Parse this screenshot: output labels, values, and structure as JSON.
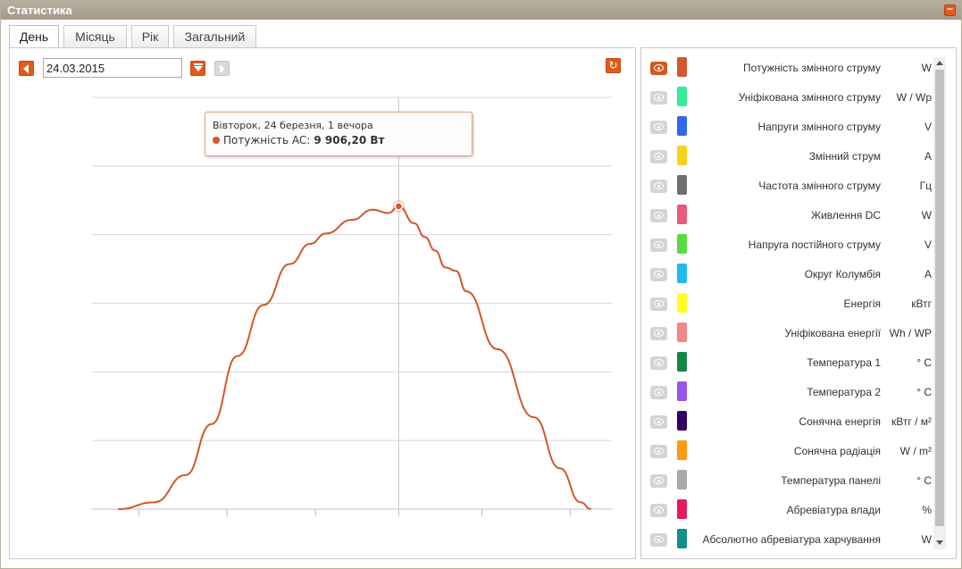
{
  "window": {
    "title": "Статистика",
    "minimize_label": "−"
  },
  "tabs": [
    {
      "label": "День",
      "active": true
    },
    {
      "label": "Місяць",
      "active": false
    },
    {
      "label": "Рік",
      "active": false
    },
    {
      "label": "Загальний",
      "active": false
    }
  ],
  "toolbar": {
    "date_value": "24.03.2015",
    "refresh_icon": "refresh-icon"
  },
  "tooltip": {
    "date": "Вівторок, 24 березня, 1 вечора",
    "series_label": "Потужність AC:",
    "value": "9 906,20 Вт"
  },
  "chart_data": {
    "type": "line",
    "series": [
      {
        "color": "#d2572a",
        "points": [
          [
            0.05,
            0.0
          ],
          [
            0.12,
            0.02
          ],
          [
            0.18,
            0.1
          ],
          [
            0.23,
            0.25
          ],
          [
            0.28,
            0.45
          ],
          [
            0.33,
            0.6
          ],
          [
            0.38,
            0.72
          ],
          [
            0.42,
            0.78
          ],
          [
            0.45,
            0.81
          ],
          [
            0.5,
            0.85
          ],
          [
            0.54,
            0.88
          ],
          [
            0.57,
            0.87
          ],
          [
            0.59,
            0.89
          ],
          [
            0.62,
            0.84
          ],
          [
            0.64,
            0.8
          ],
          [
            0.66,
            0.76
          ],
          [
            0.68,
            0.71
          ],
          [
            0.7,
            0.7
          ],
          [
            0.72,
            0.64
          ],
          [
            0.78,
            0.47
          ],
          [
            0.85,
            0.27
          ],
          [
            0.9,
            0.12
          ],
          [
            0.94,
            0.02
          ],
          [
            0.96,
            0.0
          ]
        ]
      }
    ],
    "ylim": [
      0,
      1
    ],
    "grid": true,
    "peak_marker_index": 12
  },
  "legend": {
    "items": [
      {
        "label": "Потужність змінного струму",
        "unit": "W",
        "color": "#d2572a",
        "visible": true
      },
      {
        "label": "Уніфікована змінного струму",
        "unit": "W / Wp",
        "color": "#33ee99",
        "visible": false
      },
      {
        "label": "Напруги змінного струму",
        "unit": "V",
        "color": "#3366ee",
        "visible": false
      },
      {
        "label": "Змінний струм",
        "unit": "A",
        "color": "#f5d21a",
        "visible": false
      },
      {
        "label": "Частота змінного струму",
        "unit": "Гц",
        "color": "#6f6f6f",
        "visible": false
      },
      {
        "label": "Живлення DC",
        "unit": "W",
        "color": "#e85a7c",
        "visible": false
      },
      {
        "label": "Напруга постійного струму",
        "unit": "V",
        "color": "#55dd44",
        "visible": false
      },
      {
        "label": "Округ Колумбія",
        "unit": "A",
        "color": "#22bbee",
        "visible": false
      },
      {
        "label": "Енергія",
        "unit": "кВтг",
        "color": "#ffff22",
        "visible": false
      },
      {
        "label": "Уніфікована енергії",
        "unit": "Wh / WP",
        "color": "#f08888",
        "visible": false
      },
      {
        "label": "Температура 1",
        "unit": "° C",
        "color": "#118844",
        "visible": false
      },
      {
        "label": "Температура 2",
        "unit": "° C",
        "color": "#9955ee",
        "visible": false
      },
      {
        "label": "Сонячна енергія",
        "unit": "кВтг / м²",
        "color": "#330066",
        "visible": false
      },
      {
        "label": "Сонячна радіація",
        "unit": "W / m²",
        "color": "#ff9911",
        "visible": false
      },
      {
        "label": "Температура панелі",
        "unit": "° C",
        "color": "#aaaaaa",
        "visible": false
      },
      {
        "label": "Абревіатура влади",
        "unit": "%",
        "color": "#e8195f",
        "visible": false
      },
      {
        "label": "Абсолютно абревіатура харчування",
        "unit": "W",
        "color": "#118f8a",
        "visible": false
      }
    ]
  }
}
